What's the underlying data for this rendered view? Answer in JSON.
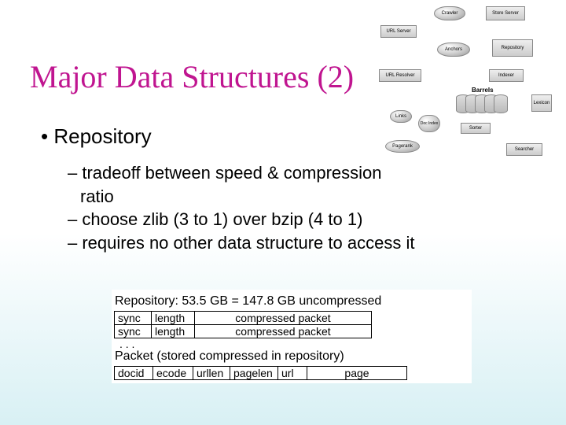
{
  "title": "Major Data Structures (2)",
  "bullet1": "• Repository",
  "sub": [
    "– tradeoff between speed & compression",
    "ratio",
    "– choose zlib (3 to 1) over bzip (4 to 1)",
    "– requires no other data structure to access it"
  ],
  "arch": {
    "nodes": {
      "crawler": "Crawler",
      "storeserver": "Store Server",
      "urlserver": "URL Server",
      "anchors": "Anchors",
      "repository": "Repository",
      "urlresolver": "URL Resolver",
      "indexer": "Indexer",
      "links": "Links",
      "docindex": "Doc\nIndex",
      "sorter": "Sorter",
      "lexicon": "Lexicon",
      "pagerank": "Pagerank",
      "searcher": "Searcher",
      "barrels": "Barrels"
    }
  },
  "tables": {
    "repo_label": "Repository: 53.5 GB = 147.8 GB uncompressed",
    "repo_row": {
      "c1": "sync",
      "c2": "length",
      "c3": "compressed packet"
    },
    "dots": ". . .",
    "packet_label": "Packet (stored compressed in repository)",
    "packet_row": {
      "c1": "docid",
      "c2": "ecode",
      "c3": "urllen",
      "c4": "pagelen",
      "c5": "url",
      "c6": "page"
    }
  }
}
